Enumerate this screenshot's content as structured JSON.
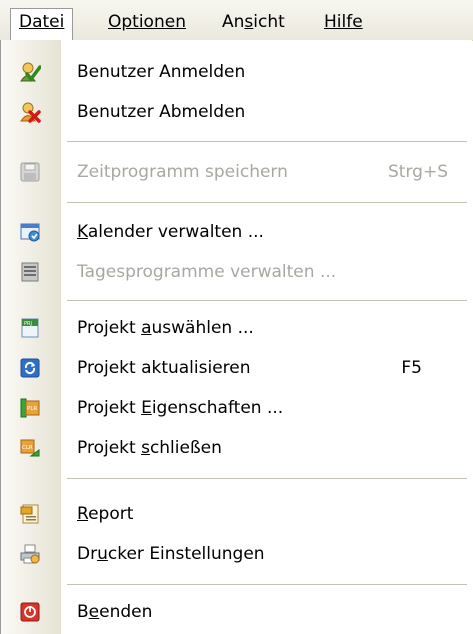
{
  "menubar": {
    "datei": "Datei",
    "optionen": "Optionen",
    "ansicht_pre": "An",
    "ansicht_u": "s",
    "ansicht_post": "icht",
    "hilfe": "Hilfe"
  },
  "menu": {
    "login": {
      "label": "Benutzer Anmelden",
      "icon": "user-check-icon"
    },
    "logout": {
      "label": "Benutzer Abmelden",
      "icon": "user-remove-icon"
    },
    "save": {
      "label": "Zeitprogramm speichern",
      "shortcut": "Strg+S",
      "icon": "save-icon",
      "enabled": false
    },
    "calendar": {
      "u": "K",
      "rest": "alender verwalten ...",
      "icon": "calendar-icon"
    },
    "daily": {
      "label": "Tagesprogramme verwalten ...",
      "icon": "daily-program-icon",
      "enabled": false
    },
    "select": {
      "pre": "Projekt ",
      "u": "a",
      "rest": "uswählen ...",
      "icon": "project-select-icon"
    },
    "refresh": {
      "label": "Projekt aktualisieren",
      "shortcut": "F5",
      "icon": "refresh-icon"
    },
    "props": {
      "pre": "Projekt ",
      "u": "E",
      "rest": "igenschaften ...",
      "icon": "project-properties-icon"
    },
    "close": {
      "pre": "Projekt ",
      "u": "s",
      "rest": "chließen",
      "icon": "project-close-icon"
    },
    "report": {
      "u": "R",
      "rest": "eport",
      "icon": "report-icon"
    },
    "printer": {
      "pre": "Dr",
      "u": "u",
      "rest": "cker Einstellungen",
      "icon": "printer-icon"
    },
    "exit": {
      "pre": "B",
      "u": "e",
      "rest": "enden",
      "icon": "exit-icon"
    }
  }
}
